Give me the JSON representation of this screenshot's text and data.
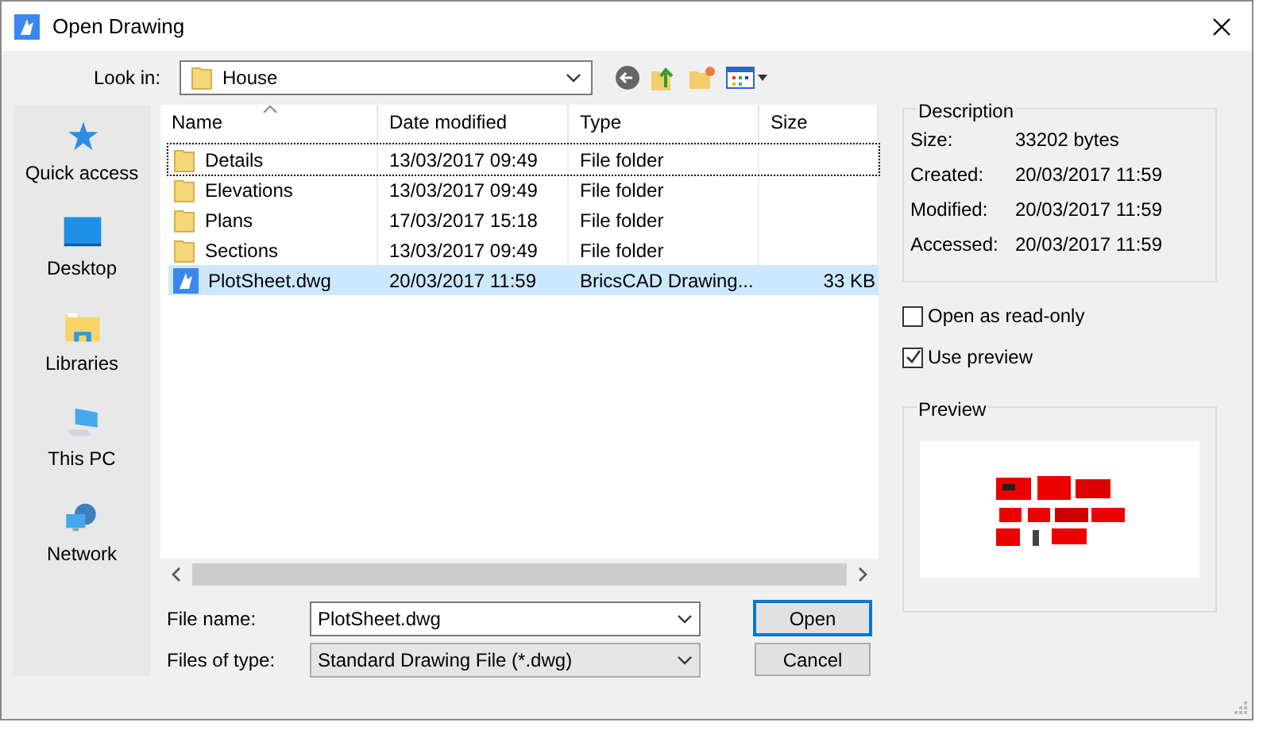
{
  "window": {
    "title": "Open Drawing"
  },
  "look_in": {
    "label": "Look in:",
    "value": "House"
  },
  "places": [
    {
      "label": "Quick access",
      "kind": "star"
    },
    {
      "label": "Desktop",
      "kind": "desktop"
    },
    {
      "label": "Libraries",
      "kind": "libraries"
    },
    {
      "label": "This PC",
      "kind": "pc"
    },
    {
      "label": "Network",
      "kind": "network"
    }
  ],
  "table": {
    "columns": [
      "Name",
      "Date modified",
      "Type",
      "Size"
    ],
    "rows": [
      {
        "kind": "folder",
        "name": "Details",
        "date": "13/03/2017 09:49",
        "type": "File folder",
        "focused": true,
        "selected": false
      },
      {
        "kind": "folder",
        "name": "Elevations",
        "date": "13/03/2017 09:49",
        "type": "File folder",
        "focused": false,
        "selected": false
      },
      {
        "kind": "folder",
        "name": "Plans",
        "date": "17/03/2017 15:18",
        "type": "File folder",
        "focused": false,
        "selected": false
      },
      {
        "kind": "folder",
        "name": "Sections",
        "date": "13/03/2017 09:49",
        "type": "File folder",
        "focused": false,
        "selected": false
      },
      {
        "kind": "drawing",
        "name": "PlotSheet.dwg",
        "date": "20/03/2017 11:59",
        "type": "BricsCAD Drawing...",
        "size": "33 KB",
        "focused": false,
        "selected": true
      }
    ]
  },
  "file_name": {
    "label": "File name:",
    "value": "PlotSheet.dwg"
  },
  "file_type": {
    "label": "Files of type:",
    "value": "Standard Drawing File (*.dwg)"
  },
  "buttons": [
    {
      "label": "Open",
      "default": true
    },
    {
      "label": "Cancel",
      "default": false
    }
  ],
  "description": {
    "title": "Description",
    "items": [
      {
        "label": "Size:",
        "value": "33202 bytes"
      },
      {
        "label": "Created:",
        "value": "20/03/2017 11:59"
      },
      {
        "label": "Modified:",
        "value": "20/03/2017 11:59"
      },
      {
        "label": "Accessed:",
        "value": "20/03/2017 11:59"
      }
    ]
  },
  "options": [
    {
      "label": "Open as read-only",
      "checked": false
    },
    {
      "label": "Use preview",
      "checked": true
    }
  ],
  "preview": {
    "title": "Preview"
  }
}
